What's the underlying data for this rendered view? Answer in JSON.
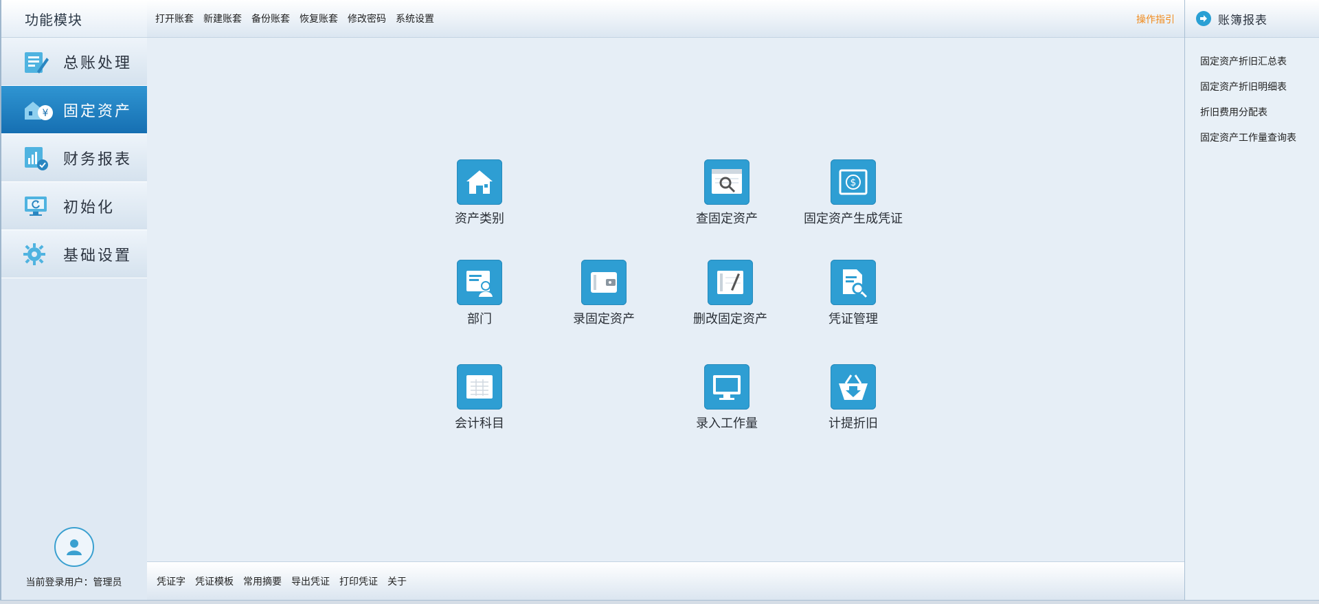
{
  "sidebar": {
    "title": "功能模块",
    "items": [
      {
        "label": "总账处理",
        "icon": "ledger-edit-icon",
        "active": false
      },
      {
        "label": "固定资产",
        "icon": "fixed-asset-icon",
        "active": true
      },
      {
        "label": "财务报表",
        "icon": "report-chart-icon",
        "active": false
      },
      {
        "label": "初始化",
        "icon": "monitor-refresh-icon",
        "active": false
      },
      {
        "label": "基础设置",
        "icon": "gear-icon",
        "active": false
      }
    ],
    "user_label": "当前登录用户：管理员"
  },
  "topbar": {
    "menu": [
      "打开账套",
      "新建账套",
      "备份账套",
      "恢复账套",
      "修改密码",
      "系统设置"
    ],
    "guide": "操作指引"
  },
  "tiles": [
    {
      "label": "资产类别",
      "icon": "house-icon"
    },
    {
      "label": "查固定资产",
      "icon": "search-document-icon"
    },
    {
      "label": "固定资产生成凭证",
      "icon": "dollar-refresh-icon"
    },
    {
      "label": "部门",
      "icon": "person-card-icon"
    },
    {
      "label": "录固定资产",
      "icon": "safe-box-icon"
    },
    {
      "label": "删改固定资产",
      "icon": "notebook-pen-icon"
    },
    {
      "label": "凭证管理",
      "icon": "document-search-icon"
    },
    {
      "label": "会计科目",
      "icon": "ledger-table-icon"
    },
    {
      "label": "录入工作量",
      "icon": "monitor-icon"
    },
    {
      "label": "计提折旧",
      "icon": "basket-download-icon"
    }
  ],
  "bottombar": {
    "menu": [
      "凭证字",
      "凭证模板",
      "常用摘要",
      "导出凭证",
      "打印凭证",
      "关于"
    ]
  },
  "rightpanel": {
    "title": "账簿报表",
    "links": [
      "固定资产折旧汇总表",
      "固定资产折旧明细表",
      "折旧费用分配表",
      "固定资产工作量查询表"
    ]
  },
  "colors": {
    "accent": "#2e9ed3",
    "active_nav": "#1f7fc0",
    "guide": "#f08a1c"
  }
}
